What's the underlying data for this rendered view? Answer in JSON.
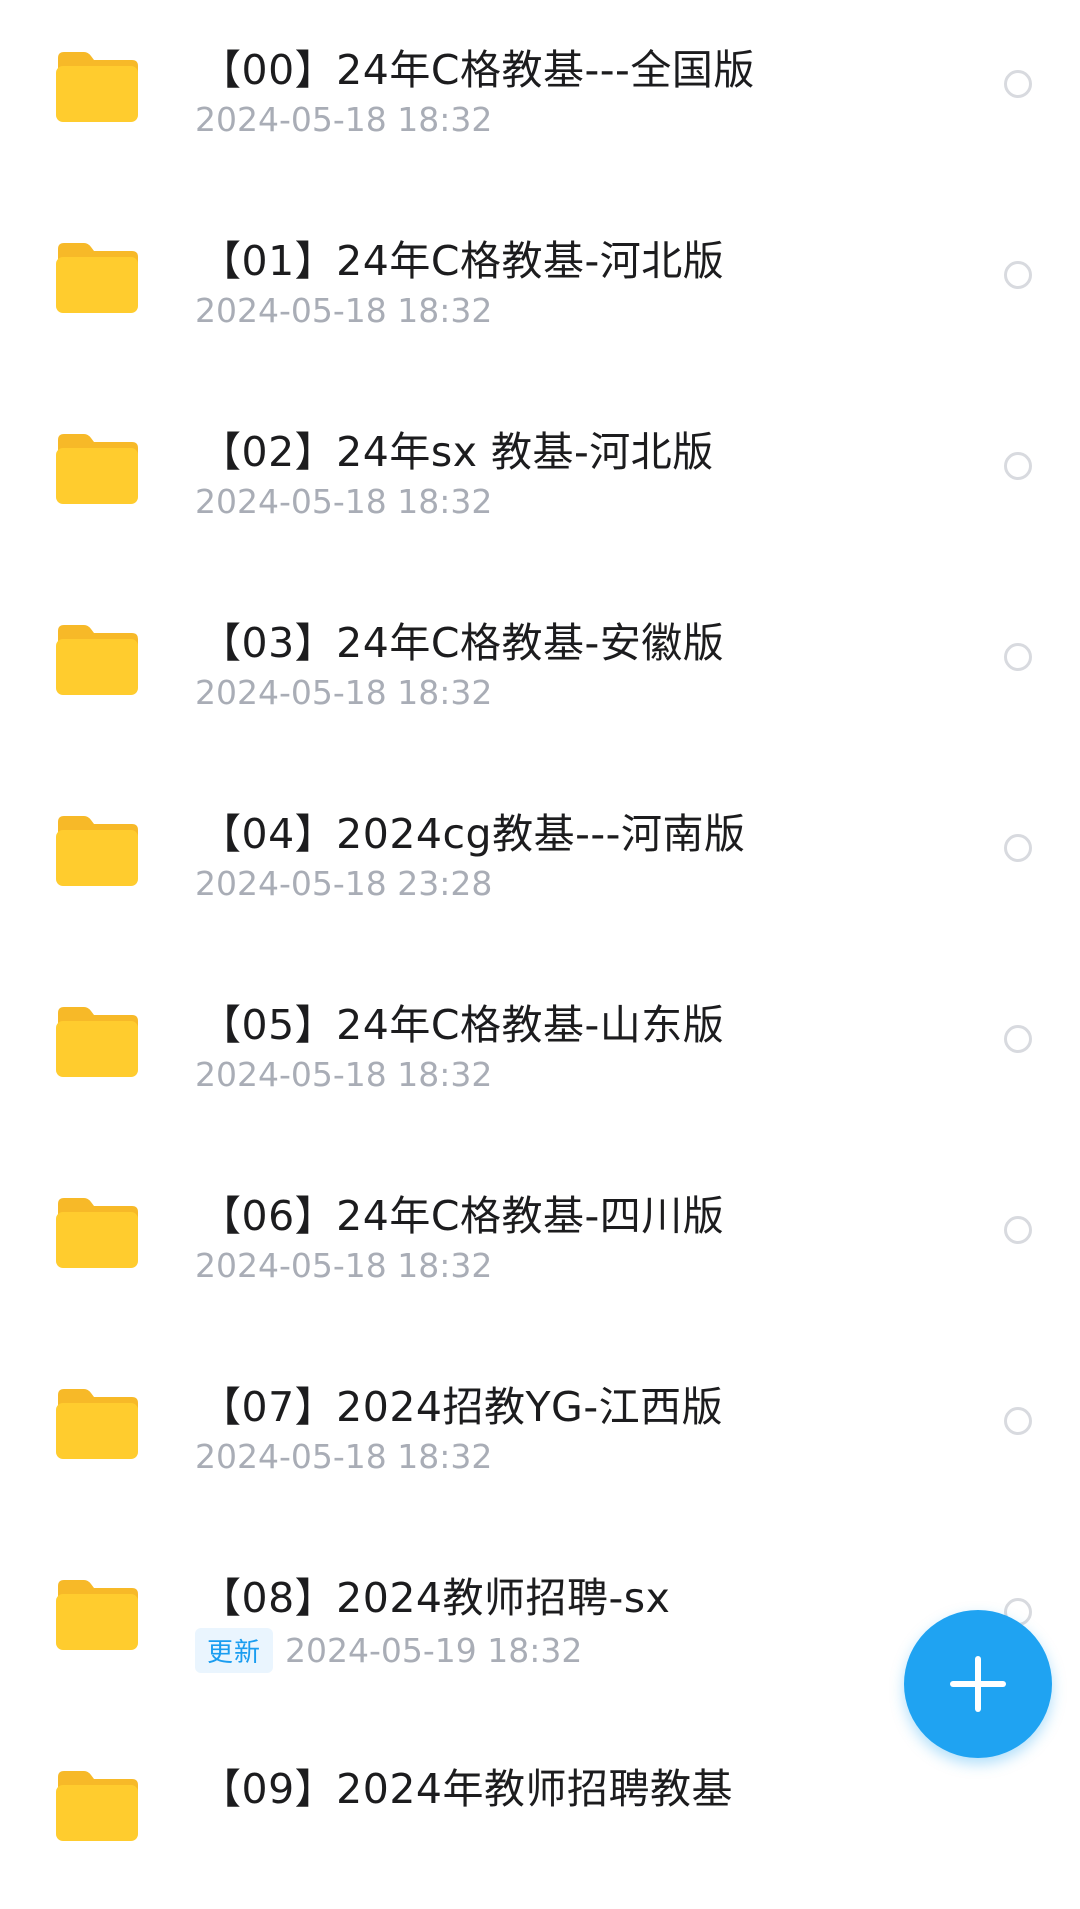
{
  "colors": {
    "folder": "#ffcc2e",
    "folder_back": "#f7b928",
    "accent": "#1fa3f2",
    "date_text": "#a9adb6",
    "title_text": "#1c1c1e"
  },
  "files": [
    {
      "name": "【00】24年C格教基---全国版",
      "date": "2024-05-18 18:32",
      "icon": "folder-icon"
    },
    {
      "name": "【01】24年C格教基-河北版",
      "date": "2024-05-18 18:32",
      "icon": "folder-icon"
    },
    {
      "name": "【02】24年sx 教基-河北版",
      "date": "2024-05-18 18:32",
      "icon": "folder-icon"
    },
    {
      "name": "【03】24年C格教基-安徽版",
      "date": "2024-05-18 18:32",
      "icon": "folder-icon"
    },
    {
      "name": "【04】2024cg教基---河南版",
      "date": "2024-05-18 23:28",
      "icon": "folder-icon"
    },
    {
      "name": "【05】24年C格教基-山东版",
      "date": "2024-05-18 18:32",
      "icon": "folder-icon"
    },
    {
      "name": "【06】24年C格教基-四川版",
      "date": "2024-05-18 18:32",
      "icon": "folder-icon"
    },
    {
      "name": "【07】2024招教YG-江西版",
      "date": "2024-05-18 18:32",
      "icon": "folder-icon"
    },
    {
      "name": "【08】2024教师招聘-sx",
      "date": "2024-05-19 18:32",
      "badge": "更新",
      "icon": "folder-icon"
    },
    {
      "name": "【09】2024年教师招聘教基",
      "date": "",
      "icon": "folder-icon"
    }
  ],
  "fab": {
    "icon": "plus-icon"
  }
}
